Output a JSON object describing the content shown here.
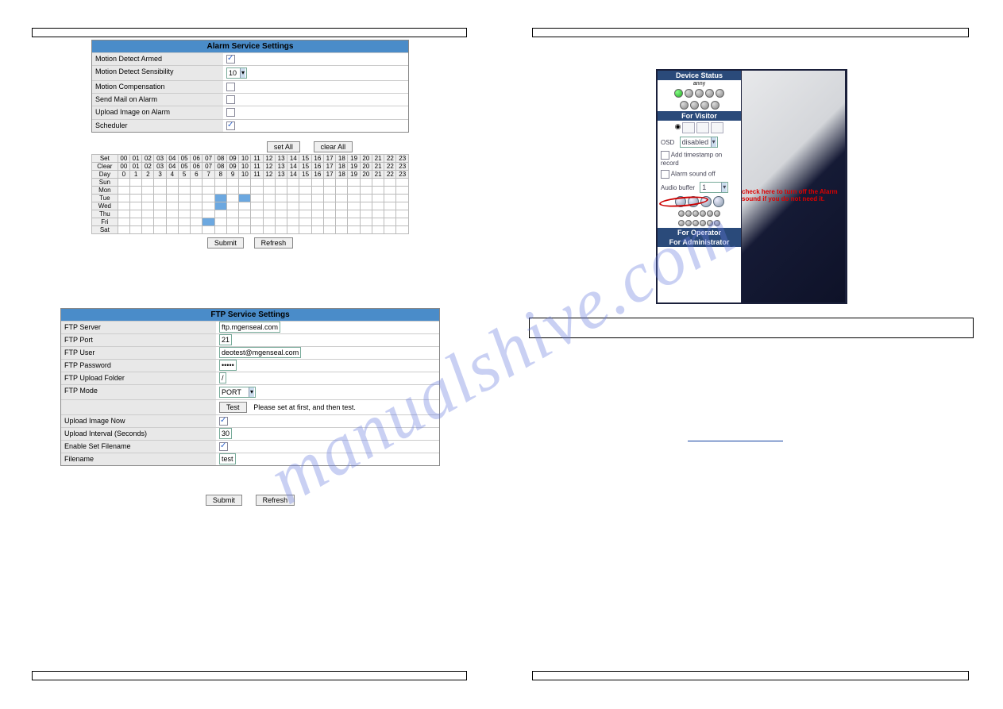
{
  "watermark": "manualshive.com",
  "alarm": {
    "title": "Alarm Service Settings",
    "motion_detect_armed": "Motion Detect Armed",
    "motion_detect_sensibility": "Motion Detect Sensibility",
    "sensibility_value": "10",
    "motion_compensation": "Motion Compensation",
    "send_mail": "Send Mail on Alarm",
    "upload_image": "Upload Image on Alarm",
    "scheduler": "Scheduler",
    "set_all": "set All",
    "clear_all": "clear All",
    "hours": [
      "00",
      "01",
      "02",
      "03",
      "04",
      "05",
      "06",
      "07",
      "08",
      "09",
      "10",
      "11",
      "12",
      "13",
      "14",
      "15",
      "16",
      "17",
      "18",
      "19",
      "20",
      "21",
      "22",
      "23"
    ],
    "set_label": "Set",
    "clear_label": "Clear",
    "day_label": "Day",
    "days": [
      "Sun",
      "Mon",
      "Tue",
      "Wed",
      "Thu",
      "Fri",
      "Sat"
    ],
    "submit": "Submit",
    "refresh": "Refresh"
  },
  "ftp": {
    "title": "FTP Service Settings",
    "server_label": "FTP Server",
    "server_value": "ftp.mgenseal.com",
    "port_label": "FTP Port",
    "port_value": "21",
    "user_label": "FTP User",
    "user_value": "deotest@mgenseal.com",
    "password_label": "FTP Password",
    "password_value": "•••••",
    "folder_label": "FTP Upload Folder",
    "folder_value": "/",
    "mode_label": "FTP Mode",
    "mode_value": "PORT",
    "test_label": "Test",
    "test_hint": "Please set at first, and then test.",
    "upload_now_label": "Upload Image Now",
    "interval_label": "Upload Interval (Seconds)",
    "interval_value": "30",
    "enable_filename_label": "Enable Set Filename",
    "filename_label": "Filename",
    "filename_value": "test",
    "submit": "Submit",
    "refresh": "Refresh"
  },
  "device": {
    "status": "Device Status",
    "anny": "anny",
    "visitor": "For Visitor",
    "osd_label": "OSD",
    "osd_value": "disabled",
    "timestamp": "Add timestamp on record",
    "alarm_off": "Alarm sound off",
    "audio_buffer_label": "Audio buffer",
    "audio_buffer_value": "1",
    "operator": "For Operator",
    "admin": "For Administrator",
    "red_annotation": "check here to turn off the Alarm sound if you do not need it."
  }
}
